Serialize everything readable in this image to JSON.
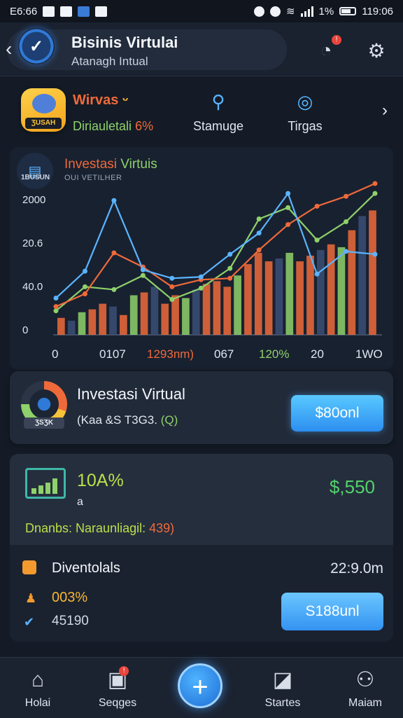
{
  "status_bar": {
    "time": "E6:66",
    "battery": "1%",
    "clock": "119:06"
  },
  "header": {
    "title": "Bisinis Virtulai",
    "subtitle": "Atanagh Intual"
  },
  "quick": {
    "coin_label": "ƷUSAH",
    "title": "Wirvas",
    "title_emoji": "ᵕ",
    "sub": "Diriauletali",
    "sub_pct": "6%",
    "item1": "Stamuge",
    "item2": "Tirgas"
  },
  "chart_card": {
    "icon_label": "1BUSUN",
    "title_a": "Investasi",
    "title_b": "Virtuis",
    "subtitle": "OUI VETILHER"
  },
  "chart_data": {
    "type": "bar",
    "y_tick_labels": [
      "2000",
      "20.6",
      "40.0",
      "0"
    ],
    "x_tick_labels": [
      "0",
      "0107",
      "1293nm)",
      "067",
      "120%",
      "20",
      "1WO"
    ],
    "colors": {
      "blue": "#5ab4ff",
      "orange": "#ef6a3a",
      "green": "#8fd16a",
      "dark": "#3b4f77"
    },
    "bars": [
      12,
      10,
      16,
      18,
      22,
      20,
      14,
      28,
      30,
      34,
      22,
      28,
      26,
      32,
      36,
      38,
      34,
      42,
      50,
      58,
      52,
      54,
      58,
      52,
      56,
      60,
      64,
      62,
      74,
      84,
      88
    ],
    "line_blue": [
      26,
      45,
      95,
      46,
      40,
      41,
      57,
      72,
      100,
      43,
      59,
      57
    ],
    "line_orange": [
      20,
      29,
      58,
      48,
      34,
      39,
      40,
      60,
      78,
      91,
      98,
      107
    ],
    "line_green": [
      17,
      34,
      32,
      42,
      25,
      33,
      47,
      82,
      90,
      67,
      80,
      100
    ]
  },
  "invest": {
    "gauge_label": "ƷSƷK",
    "title": "Investasi Virtual",
    "sub_a": "(Kaa &S T3G3.",
    "sub_b": "(Q)",
    "amount": "$80onl"
  },
  "stats": {
    "pct": "10A%",
    "small": "a",
    "dollar": "$,550",
    "line_a": "Dnanbs: Naraunliagil:",
    "line_b": "439)"
  },
  "dividen": {
    "title": "Diventolals",
    "time": "22:9.0m",
    "pct": "003%",
    "num": "45190",
    "button": "S188unl"
  },
  "nav": {
    "home": "Holai",
    "pages": "Seqges",
    "stats": "Startes",
    "profile": "Maiam"
  }
}
